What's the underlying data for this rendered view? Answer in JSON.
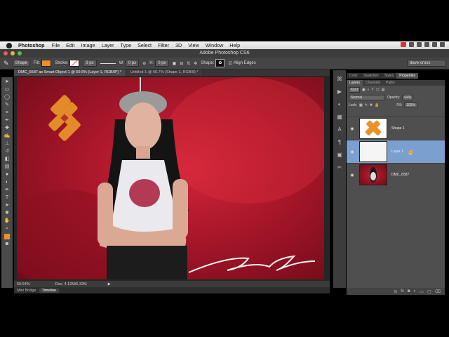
{
  "menubar": {
    "app_name": "Photoshop",
    "items": [
      "File",
      "Edit",
      "Image",
      "Layer",
      "Type",
      "Select",
      "Filter",
      "3D",
      "View",
      "Window",
      "Help"
    ]
  },
  "window": {
    "title": "Adobe Photoshop CS6"
  },
  "options": {
    "mode": "Shape",
    "fill_label": "Fill:",
    "stroke_label": "Stroke:",
    "stroke_size": "3 px",
    "w_label": "W:",
    "w_value": "0 px",
    "h_label": "H:",
    "h_value": "0 px",
    "shape_label": "Shape:",
    "align_edges": "Align Edges",
    "workspace": "dave-cross",
    "fill_color": "#e8922a"
  },
  "tabs": [
    "DMC_6587 as Smart Object-1 @ 50.6% (Layer 1, RGB/8*) *",
    "Untitled-1 @ 66.7% (Shape 1, RGB/8) *"
  ],
  "status": {
    "zoom": "50.64%",
    "doc": "Doc: 4.12M/6.32M"
  },
  "bottom_tabs": [
    "Mini Bridge",
    "Timeline"
  ],
  "panel_tabs_top": [
    "Color",
    "Swatches",
    "Styles",
    "Properties"
  ],
  "layers_panel": {
    "tabs": [
      "Layers",
      "Channels",
      "Paths"
    ],
    "kind": "Kind",
    "blend_mode": "Normal",
    "opacity_label": "Opacity:",
    "opacity": "64%",
    "lock_label": "Lock:",
    "fill_label": "Fill:",
    "fill": "100%",
    "layers": [
      {
        "name": "Shape 1"
      },
      {
        "name": "Layer 1"
      },
      {
        "name": "DMC_6587"
      }
    ]
  },
  "signature": "Dave Cross",
  "colors": {
    "accent": "#e8922a",
    "selection": "#7ba0cf",
    "backdrop_red": "#c01c30"
  }
}
